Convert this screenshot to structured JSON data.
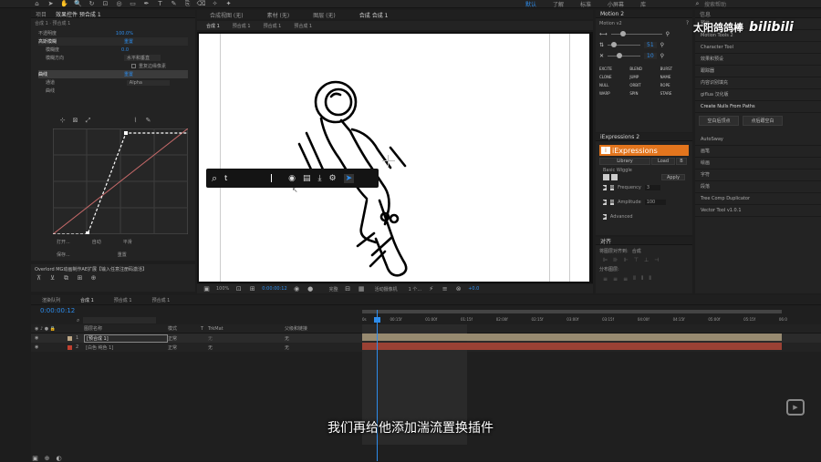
{
  "menu": {
    "right_items": [
      "默认",
      "了解",
      "标准",
      "小屏幕",
      "库"
    ],
    "search_placeholder": "搜索帮助"
  },
  "project_panel": {
    "tabs": [
      "项目",
      "效果控件 预合成 1"
    ],
    "breadcrumb": "合成 1 · 预合成 1",
    "props": [
      {
        "name": "不透明度",
        "value": "100.0%"
      },
      {
        "name": "高斯模糊",
        "value": "重置"
      },
      {
        "name": "模糊度",
        "value": "0.0"
      },
      {
        "name": "模糊方向",
        "value": "水平和垂直"
      },
      {
        "name": "",
        "value": "重复边缘像素"
      },
      {
        "name": "曲线",
        "value": "重置"
      },
      {
        "name": "通道",
        "value": "Alpha"
      },
      {
        "name": "曲线",
        "value": ""
      }
    ],
    "curve_buttons": [
      "打开...",
      "自动",
      "平滑",
      "保存...",
      "重置"
    ]
  },
  "comp_tabs": {
    "viewer_tabs": [
      "合成视图 (无)",
      "素材 (无)",
      "图层 (无)",
      "合成 合成 1"
    ],
    "sub_tabs": [
      "合成 1",
      "预合成 1",
      "预合成 1",
      "预合成 1"
    ]
  },
  "viewer_bar": {
    "zoom": "100%",
    "timecode": "0:00:00:12",
    "quality": "完整",
    "camera": "活动摄像机",
    "views": "1 个...",
    "offset": "+0.0"
  },
  "motion_panel": {
    "title": "Motion 2",
    "version": "Motion v2",
    "value1": "51",
    "value2": "10",
    "buttons": [
      "EXCITE",
      "BLEND",
      "BURST",
      "CLONE",
      "JUMP",
      "NAME",
      "NULL",
      "ORBIT",
      "ROPE",
      "WARP",
      "SPIN",
      "STARE"
    ]
  },
  "iexpressions": {
    "tab": "iExpressions 2",
    "logo": "iExpressions",
    "tabs": [
      "Library",
      "Load",
      "B"
    ],
    "script": "Basic Wiggle",
    "apply": "Apply",
    "params": [
      {
        "label": "Frequency",
        "value": "3"
      },
      {
        "label": "Amplitude",
        "value": "100"
      },
      {
        "label": "Advanced",
        "value": ""
      }
    ]
  },
  "align_panel": {
    "title": "对齐",
    "align_to_label": "将图层对齐到:",
    "align_to_value": "合成",
    "distribute_label": "分布图层:"
  },
  "right_panel": {
    "header": "信息",
    "items": [
      "预览",
      "Motion Tools 2",
      "Character Tool",
      "效果和预设",
      "跟踪器",
      "内容识别填充",
      "giflua 汉化版",
      "Create Nulls From Paths",
      "空白后顶点",
      "点后跟空白",
      "AutoSway",
      "画笔",
      "绘画",
      "字符",
      "段落",
      "Tree Comp Duplicator",
      "Vector Tool v1.0.1"
    ],
    "brand": "太阳鸽鸽棒",
    "brand_logo": "bilibili"
  },
  "search_bar": {
    "query": "t"
  },
  "footer_panel": {
    "title": "Overlord MG动画制作AE扩展【输入任意注册码激活】"
  },
  "timeline": {
    "tabs": [
      "渲染队列",
      "合成 1",
      "预合成 1",
      "预合成 1"
    ],
    "timecode": "0:00:00:12",
    "columns": [
      "图层名称",
      "模式",
      "T",
      "TrkMat",
      "父级和链接"
    ],
    "layers": [
      {
        "num": "1",
        "name": "[预合成 1]",
        "mode": "正常",
        "trk": "无",
        "parent": "无",
        "color": "#bda785"
      },
      {
        "num": "2",
        "name": "[白色 纯色 1]",
        "mode": "正常",
        "trk": "无",
        "parent": "无",
        "color": "#c0402f"
      }
    ],
    "ruler": [
      "0s",
      "00:15f",
      "01:00f",
      "01:15f",
      "02:00f",
      "02:15f",
      "03:00f",
      "03:15f",
      "04:00f",
      "04:15f",
      "05:00f",
      "05:15f",
      "06:0"
    ]
  },
  "subtitle": "我们再给他添加湍流置换插件",
  "colors": {
    "accent": "#2d8ceb",
    "layer1_bar": "#978a70",
    "layer2_bar": "#9a4134",
    "orange": "#e3751d"
  }
}
